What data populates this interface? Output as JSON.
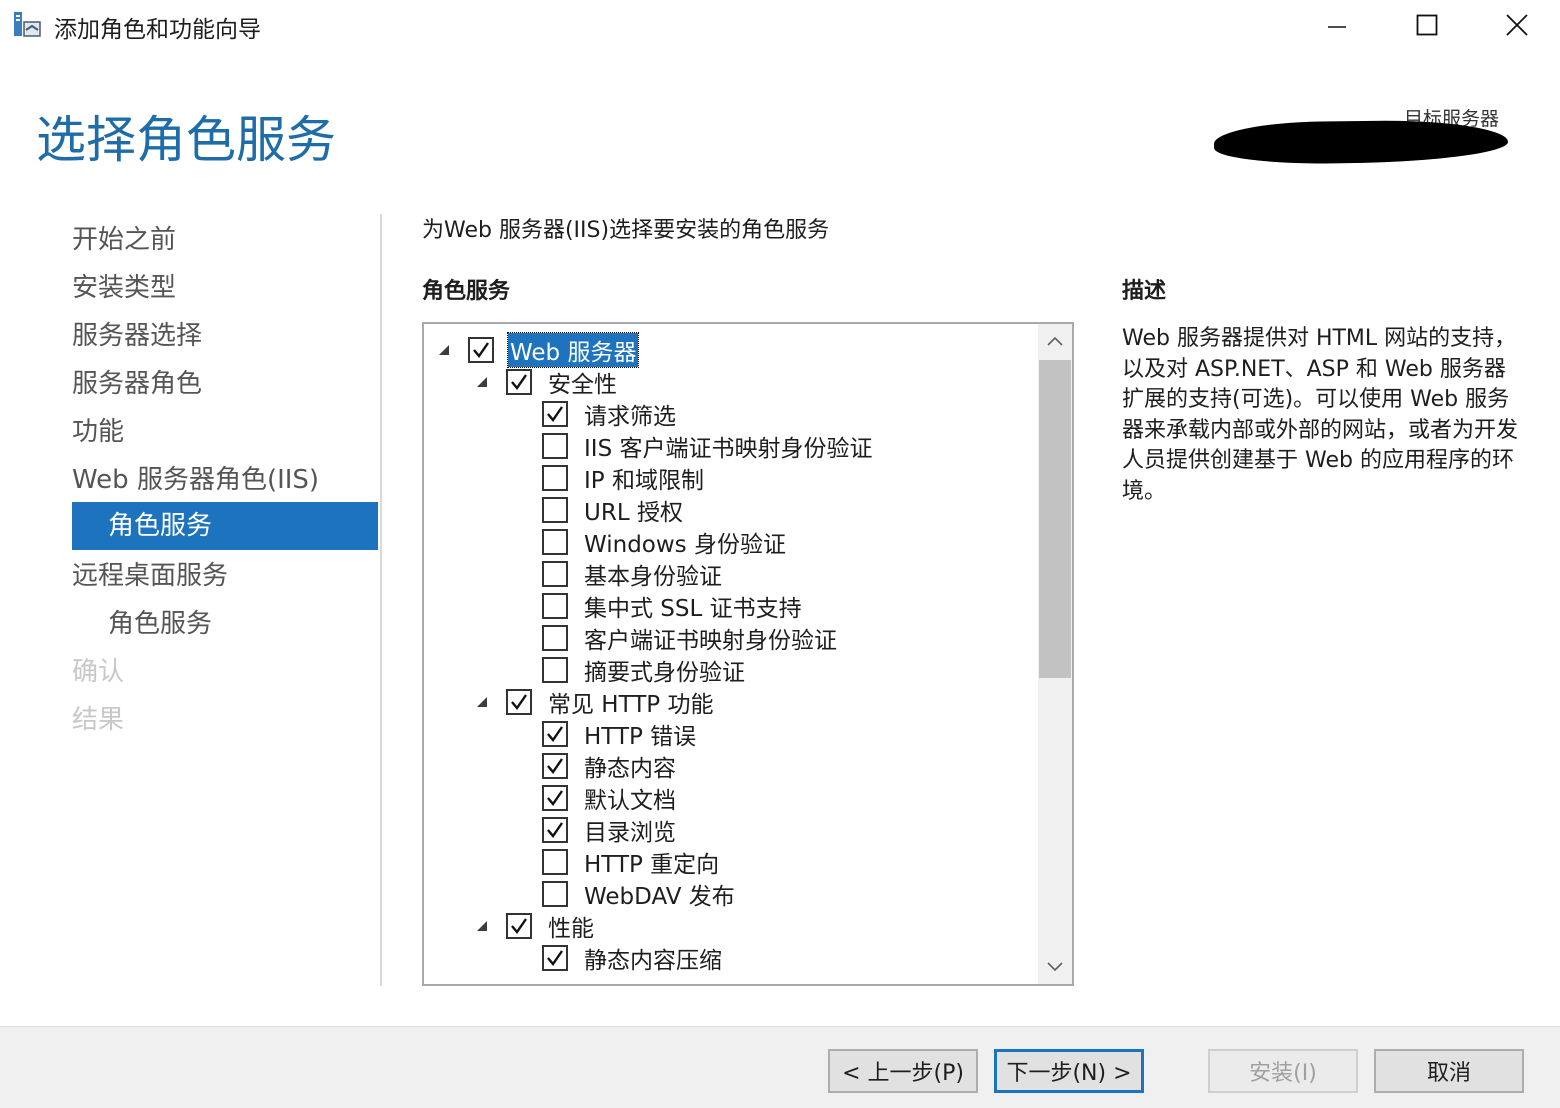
{
  "window": {
    "title": "添加角色和功能向导"
  },
  "header": {
    "title": "选择角色服务",
    "target_label": "目标服务器"
  },
  "nav": {
    "items": [
      {
        "label": "开始之前"
      },
      {
        "label": "安装类型"
      },
      {
        "label": "服务器选择"
      },
      {
        "label": "服务器角色"
      },
      {
        "label": "功能"
      },
      {
        "label": "Web 服务器角色(IIS)"
      },
      {
        "label": "角色服务"
      },
      {
        "label": "远程桌面服务"
      },
      {
        "label": "角色服务"
      },
      {
        "label": "确认"
      },
      {
        "label": "结果"
      }
    ],
    "active_index": 6
  },
  "content": {
    "intro": "为Web 服务器(IIS)选择要安装的角色服务",
    "role_services_heading": "角色服务",
    "description_heading": "描述",
    "description": "Web 服务器提供对 HTML 网站的支持，以及对 ASP.NET、ASP 和 Web 服务器扩展的支持(可选)。可以使用 Web 服务器来承载内部或外部的网站，或者为开发人员提供创建基于 Web 的应用程序的环境。"
  },
  "tree": {
    "rows": [
      {
        "label": "Web 服务器",
        "level": 0,
        "checked": true,
        "expanded": true,
        "selected": true
      },
      {
        "label": "安全性",
        "level": 1,
        "checked": true,
        "expanded": true
      },
      {
        "label": "请求筛选",
        "level": 2,
        "checked": true
      },
      {
        "label": "IIS 客户端证书映射身份验证",
        "level": 2,
        "checked": false
      },
      {
        "label": "IP 和域限制",
        "level": 2,
        "checked": false
      },
      {
        "label": "URL 授权",
        "level": 2,
        "checked": false
      },
      {
        "label": "Windows 身份验证",
        "level": 2,
        "checked": false
      },
      {
        "label": "基本身份验证",
        "level": 2,
        "checked": false
      },
      {
        "label": "集中式 SSL 证书支持",
        "level": 2,
        "checked": false
      },
      {
        "label": "客户端证书映射身份验证",
        "level": 2,
        "checked": false
      },
      {
        "label": "摘要式身份验证",
        "level": 2,
        "checked": false
      },
      {
        "label": "常见 HTTP 功能",
        "level": 1,
        "checked": true,
        "expanded": true
      },
      {
        "label": "HTTP 错误",
        "level": 2,
        "checked": true
      },
      {
        "label": "静态内容",
        "level": 2,
        "checked": true
      },
      {
        "label": "默认文档",
        "level": 2,
        "checked": true
      },
      {
        "label": "目录浏览",
        "level": 2,
        "checked": true
      },
      {
        "label": "HTTP 重定向",
        "level": 2,
        "checked": false
      },
      {
        "label": "WebDAV 发布",
        "level": 2,
        "checked": false
      },
      {
        "label": "性能",
        "level": 1,
        "checked": true,
        "expanded": true
      },
      {
        "label": "静态内容压缩",
        "level": 2,
        "checked": true
      }
    ]
  },
  "footer": {
    "prev_label": "< 上一步(P)",
    "next_label": "下一步(N) >",
    "install_label": "安装(I)",
    "cancel_label": "取消"
  },
  "colors": {
    "accent": "#1e73be",
    "heading": "#1e6ca8"
  },
  "icons": {
    "app": "server-manager-icon",
    "minimize": "minimize-icon",
    "maximize": "maximize-icon",
    "close": "close-icon",
    "expander": "tree-expanded-triangle-icon",
    "check": "checkmark-icon",
    "scroll_up": "chevron-up-icon",
    "scroll_down": "chevron-down-icon"
  }
}
